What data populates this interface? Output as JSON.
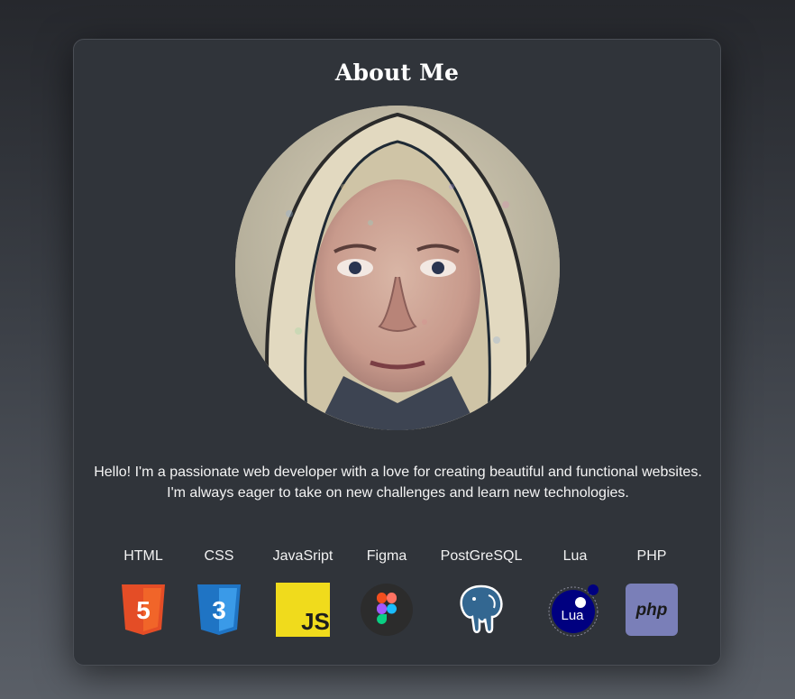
{
  "card": {
    "title": "About Me",
    "bio": "Hello! I'm a passionate web developer with a love for creating beautiful and functional websites. I'm always eager to take on new challenges and learn new technologies."
  },
  "skills": [
    {
      "label": "HTML",
      "icon": "html5-icon",
      "color": "#e44d26",
      "badge": "5"
    },
    {
      "label": "CSS",
      "icon": "css3-icon",
      "color": "#2a8fe0",
      "badge": "3"
    },
    {
      "label": "JavaSript",
      "icon": "javascript-icon",
      "color": "#f0db1c",
      "badge": "JS"
    },
    {
      "label": "Figma",
      "icon": "figma-icon",
      "color": "#2c2c2c"
    },
    {
      "label": "PostGreSQL",
      "icon": "postgresql-icon",
      "color": "#336791"
    },
    {
      "label": "Lua",
      "icon": "lua-icon",
      "color": "#000080",
      "badge": "Lua"
    },
    {
      "label": "PHP",
      "icon": "php-icon",
      "color": "#7a7fb8",
      "badge": "php"
    }
  ]
}
